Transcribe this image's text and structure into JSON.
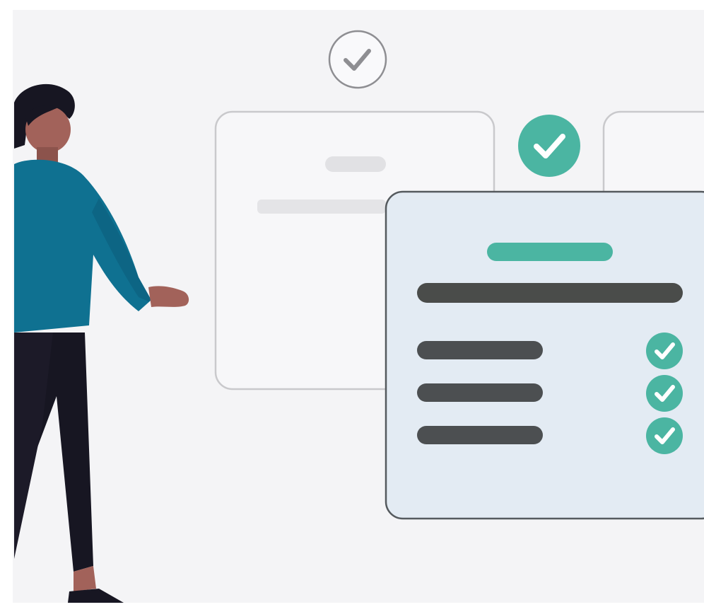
{
  "illustration": {
    "subject": "person-reviewing-checklist-cards",
    "colors": {
      "background": "#f4f4f6",
      "accent": "#4bb5a2",
      "card_border": "#c9c9cc",
      "checklist_card_fill": "#e3ebf3",
      "checklist_card_border": "#555a5e",
      "checklist_line": "#4c4f51",
      "shirt": "#0f7191",
      "pants": "#171622",
      "skin": "#a2625a",
      "hair": "#171622"
    },
    "checklist_items": [
      {
        "checked": true
      },
      {
        "checked": true
      },
      {
        "checked": true
      }
    ],
    "icons": [
      "outline-check-circle-icon",
      "filled-check-circle-icon",
      "check-circle-icon"
    ]
  }
}
